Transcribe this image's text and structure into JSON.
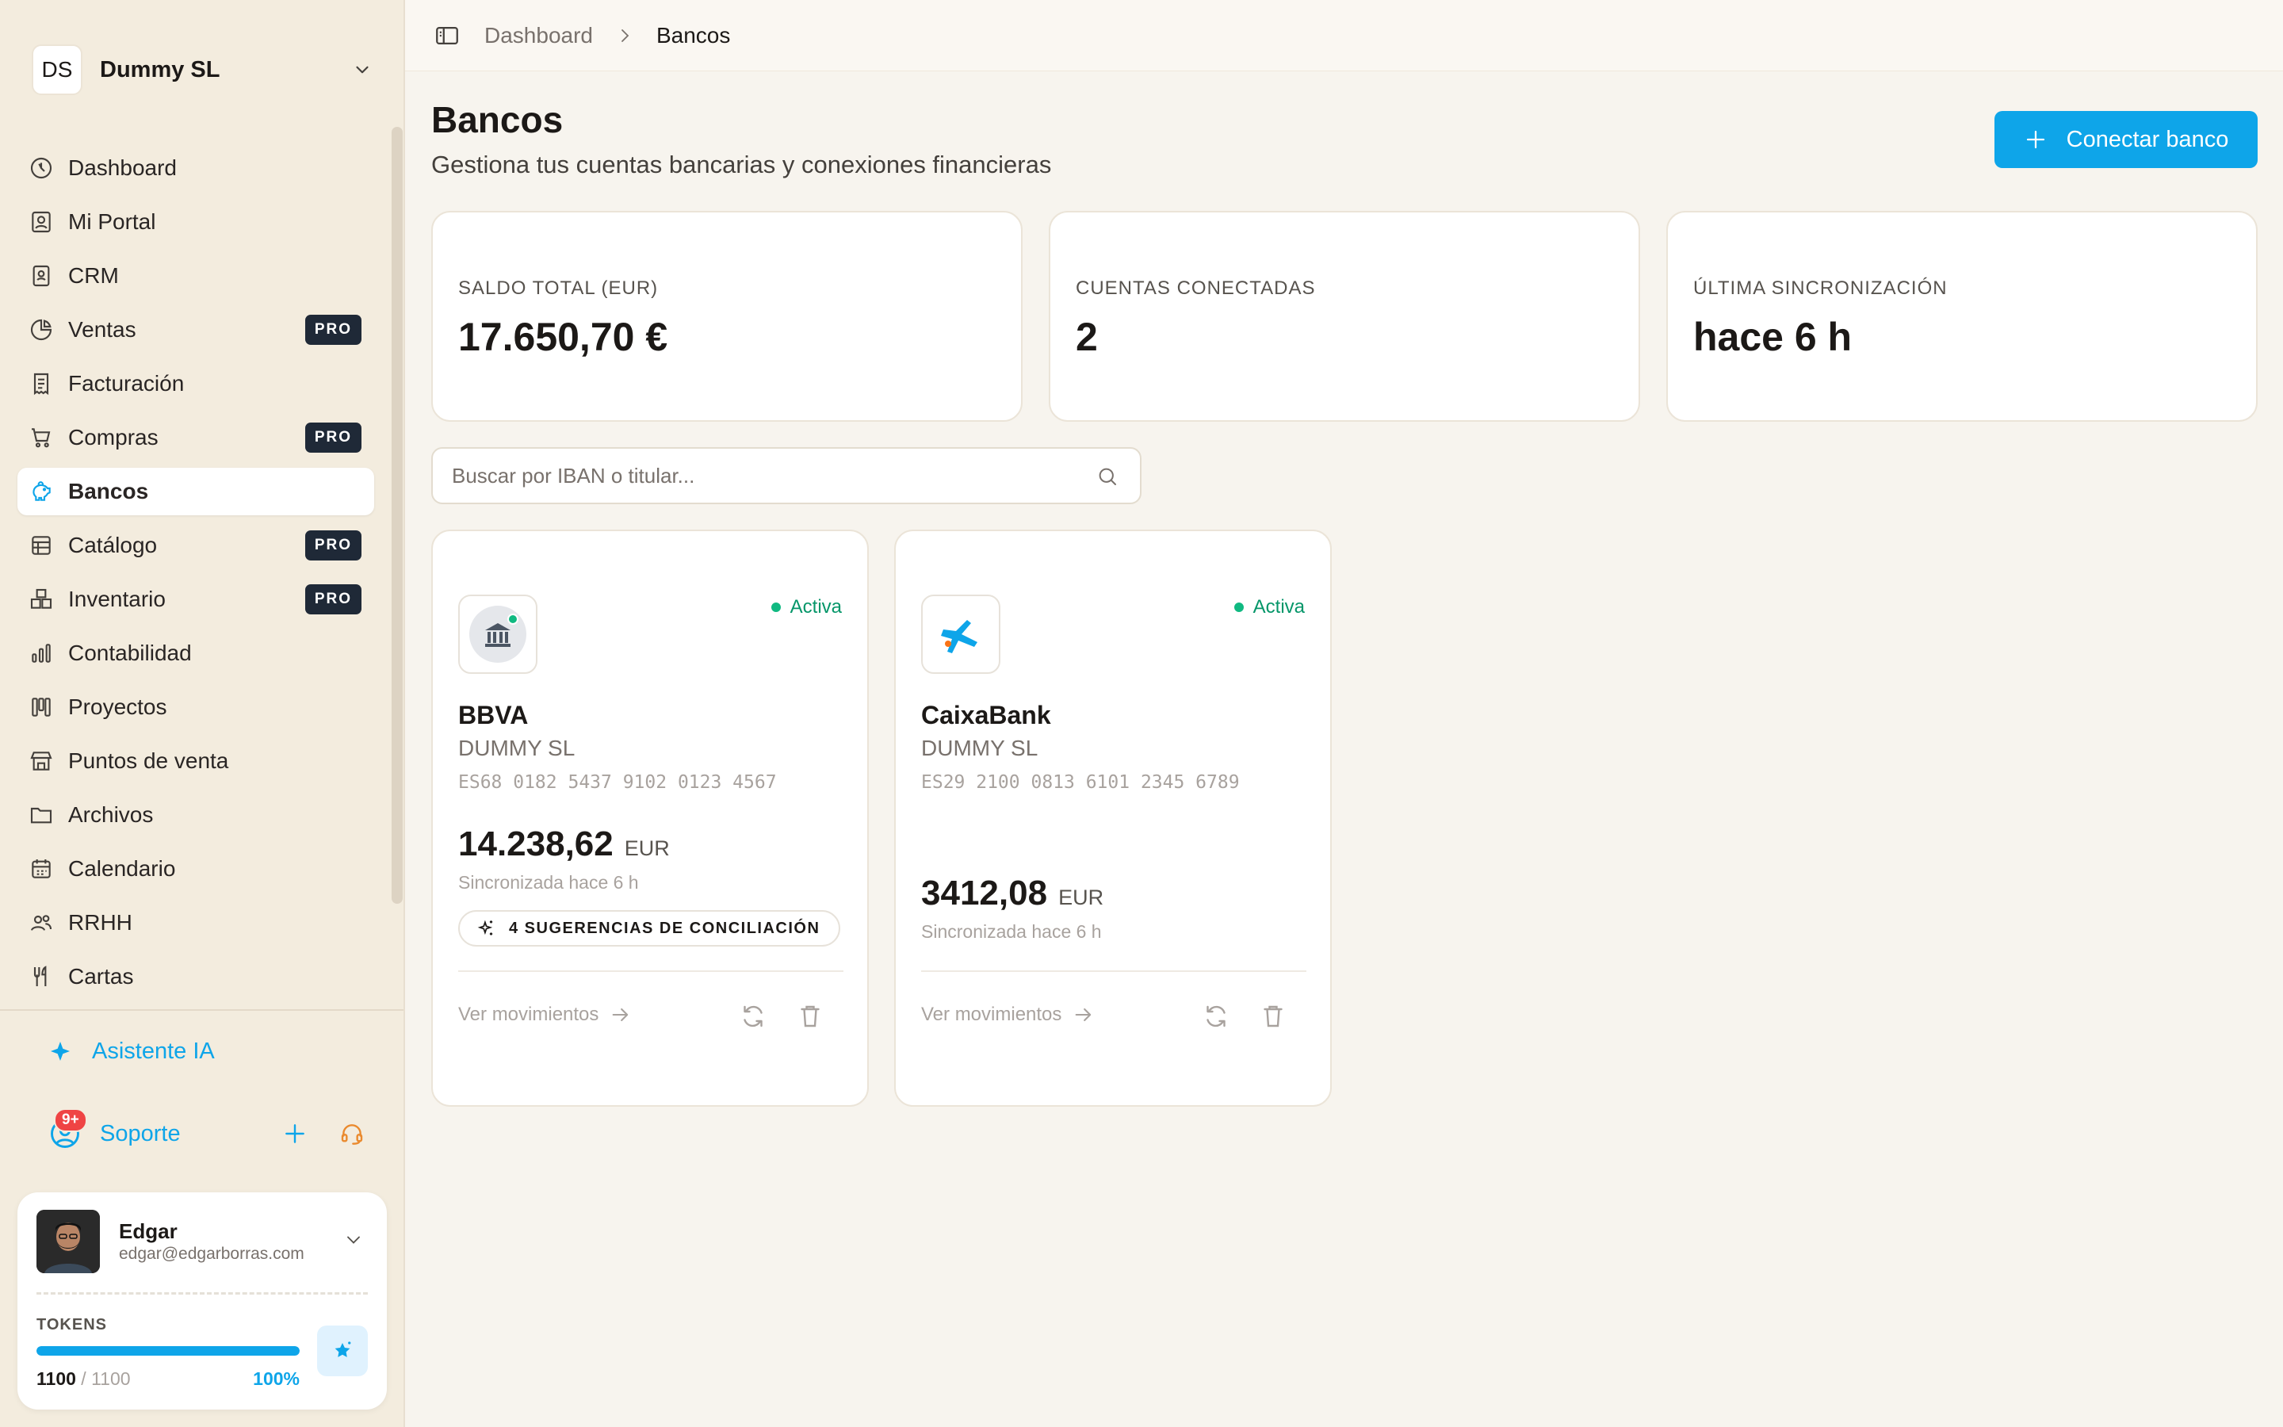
{
  "org": {
    "initials": "DS",
    "name": "Dummy SL"
  },
  "nav": [
    {
      "label": "Dashboard",
      "icon": "dashboard-icon",
      "pro": ""
    },
    {
      "label": "Mi Portal",
      "icon": "portal-icon",
      "pro": ""
    },
    {
      "label": "CRM",
      "icon": "contacts-icon",
      "pro": ""
    },
    {
      "label": "Ventas",
      "icon": "pie-chart-icon",
      "pro": "PRO"
    },
    {
      "label": "Facturación",
      "icon": "invoice-icon",
      "pro": ""
    },
    {
      "label": "Compras",
      "icon": "cart-icon",
      "pro": "PRO"
    },
    {
      "label": "Bancos",
      "icon": "piggy-bank-icon",
      "pro": "",
      "active": true
    },
    {
      "label": "Catálogo",
      "icon": "catalog-icon",
      "pro": "PRO"
    },
    {
      "label": "Inventario",
      "icon": "boxes-icon",
      "pro": "PRO"
    },
    {
      "label": "Contabilidad",
      "icon": "bar-chart-icon",
      "pro": ""
    },
    {
      "label": "Proyectos",
      "icon": "kanban-icon",
      "pro": ""
    },
    {
      "label": "Puntos de venta",
      "icon": "store-icon",
      "pro": ""
    },
    {
      "label": "Archivos",
      "icon": "folder-icon",
      "pro": ""
    },
    {
      "label": "Calendario",
      "icon": "calendar-icon",
      "pro": ""
    },
    {
      "label": "RRHH",
      "icon": "users-icon",
      "pro": ""
    },
    {
      "label": "Cartas",
      "icon": "utensils-icon",
      "pro": ""
    }
  ],
  "assistant": {
    "label": "Asistente IA"
  },
  "support": {
    "label": "Soporte",
    "badge": "9+"
  },
  "user": {
    "name": "Edgar",
    "email": "edgar@edgarborras.com",
    "tokens_label": "TOKENS",
    "tokens_used": "1100",
    "tokens_total": "/ 1100",
    "tokens_pct": "100%",
    "tokens_fraction": 1.0
  },
  "breadcrumb": {
    "parent": "Dashboard",
    "current": "Bancos"
  },
  "page": {
    "title": "Bancos",
    "subtitle": "Gestiona tus cuentas bancarias y conexiones financieras",
    "connect_label": "Conectar banco"
  },
  "stats": [
    {
      "label": "SALDO TOTAL (EUR)",
      "value": "17.650,70 €"
    },
    {
      "label": "CUENTAS CONECTADAS",
      "value": "2"
    },
    {
      "label": "ÚLTIMA SINCRONIZACIÓN",
      "value": "hace 6 h"
    }
  ],
  "search": {
    "placeholder": "Buscar por IBAN o titular..."
  },
  "banks": [
    {
      "name": "BBVA",
      "holder": "DUMMY SL",
      "iban": "ES68 0182 5437 9102 0123 4567",
      "balance": "14.238,62",
      "currency": "EUR",
      "synced": "Sincronizada hace 6 h",
      "status": "Activa",
      "suggestions": "4 SUGERENCIAS DE CONCILIACIÓN",
      "link": "Ver movimientos",
      "status_color": "#10b981"
    },
    {
      "name": "CaixaBank",
      "holder": "DUMMY SL",
      "iban": "ES29 2100 0813 6101 2345 6789",
      "balance": "3412,08",
      "currency": "EUR",
      "synced": "Sincronizada hace 6 h",
      "status": "Activa",
      "suggestions": "",
      "link": "Ver movimientos",
      "status_color": "#10b981"
    }
  ],
  "colors": {
    "accent": "#0ea5e9",
    "pro_badge": "#1f2937",
    "background": "#f7f4ee",
    "sidebar": "#f3ecde"
  }
}
